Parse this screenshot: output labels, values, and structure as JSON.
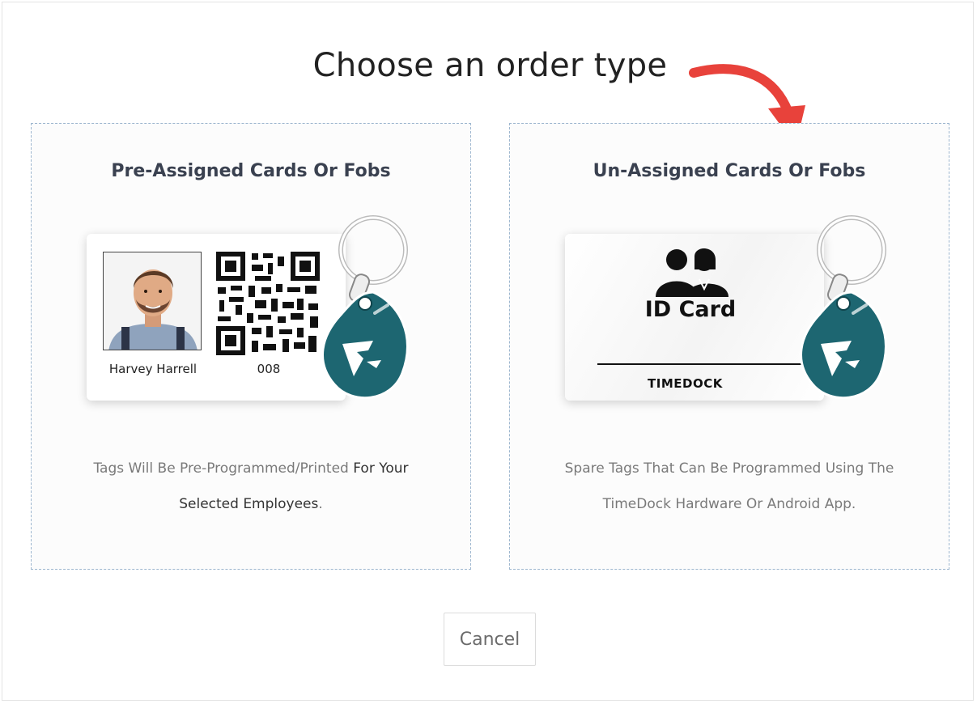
{
  "page": {
    "title": "Choose an order type"
  },
  "options": {
    "pre_assigned": {
      "title": "Pre-Assigned Cards Or Fobs",
      "card_name": "Harvey Harrell",
      "card_number": "008",
      "desc_line1_light": "Tags Will Be Pre-Programmed/Printed ",
      "desc_line1_dark": "For Your",
      "desc_line2_dark": "Selected Employees",
      "desc_line2_light": "."
    },
    "un_assigned": {
      "title": "Un-Assigned Cards Or Fobs",
      "card_title": "ID Card",
      "card_brand": "TIMEDOCK",
      "desc_line1": "Spare Tags That Can Be Programmed Using The",
      "desc_line2": "TimeDock Hardware Or Android App."
    }
  },
  "actions": {
    "cancel_label": "Cancel"
  },
  "colors": {
    "arrow": "#e8423b",
    "fob": "#1d6671",
    "option_border": "#9db6cf"
  },
  "icons": [
    "red-arrow-icon",
    "qr-code-icon",
    "employee-photo",
    "people-icon",
    "key-fob-icon",
    "timedock-logo-icon"
  ]
}
